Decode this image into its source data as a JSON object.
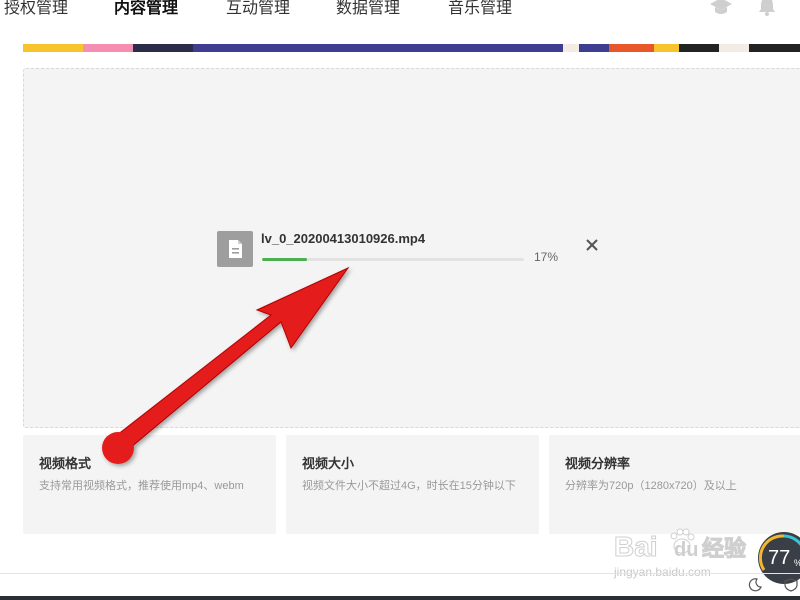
{
  "nav": {
    "items": [
      {
        "label": "授权管理",
        "active": false
      },
      {
        "label": "内容管理",
        "active": true
      },
      {
        "label": "互动管理",
        "active": false
      },
      {
        "label": "数据管理",
        "active": false
      },
      {
        "label": "音乐管理",
        "active": false
      }
    ],
    "icons": [
      "graduation-cap-icon",
      "bell-icon"
    ]
  },
  "upload": {
    "file_name": "lv_0_20200413010926.mp4",
    "progress_percent": 17,
    "progress_label": "17%",
    "progress_color": "#4caf50",
    "file_icon": "document-icon",
    "close_icon": "close-icon"
  },
  "cards": [
    {
      "title": "视频格式",
      "desc": "支持常用视频格式，推荐使用mp4、webm"
    },
    {
      "title": "视频大小",
      "desc": "视频文件大小不超过4G，时长在15分钟以下"
    },
    {
      "title": "视频分辨率",
      "desc": "分辨率为720p（1280x720）及以上"
    }
  ],
  "watermark": {
    "brand": "Bai",
    "brand2": "du",
    "cn": "经验",
    "url": "jingyan.baidu.com"
  },
  "gauge": {
    "value": "77",
    "unit": "%"
  },
  "colors": {
    "accent_arrow": "#e41e1e",
    "area_bg": "#f4f4f4"
  }
}
